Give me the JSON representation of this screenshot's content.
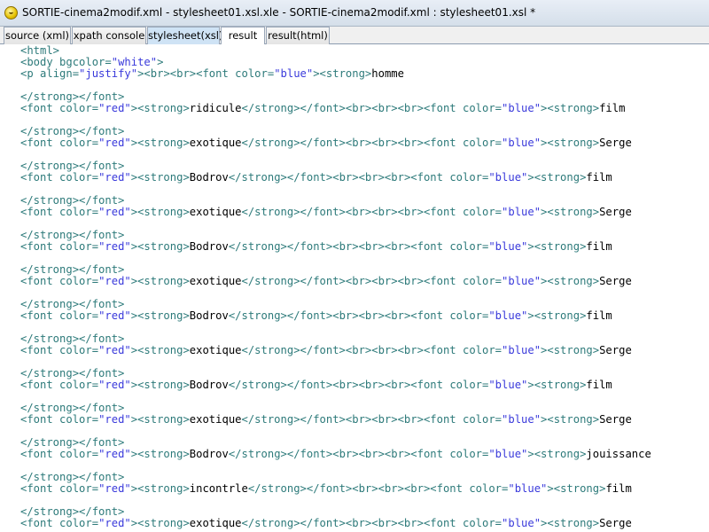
{
  "window": {
    "title": "SORTIE-cinema2modif.xml - stylesheet01.xsl.xle - SORTIE-cinema2modif.xml : stylesheet01.xsl *",
    "app_icon": "smiley-icon"
  },
  "tabs": [
    {
      "label": "source (xml)",
      "active": false
    },
    {
      "label": "xpath console",
      "active": false
    },
    {
      "label": "stylesheet(xsl)",
      "active": false,
      "highlight": true
    },
    {
      "label": "result",
      "active": true
    },
    {
      "label": "result(html)",
      "active": false
    }
  ],
  "colors": {
    "tag": "#2d7a7a",
    "attr_value": "#3a3adb",
    "text": "#000000"
  },
  "code": [
    [
      [
        "t",
        "<html>"
      ]
    ],
    [
      [
        "t",
        "<body "
      ],
      [
        "a",
        "bgcolor="
      ],
      [
        "v",
        "\"white\""
      ],
      [
        "t",
        ">"
      ]
    ],
    [
      [
        "t",
        "<p "
      ],
      [
        "a",
        "align="
      ],
      [
        "v",
        "\"justify\""
      ],
      [
        "t",
        "><br><br><font "
      ],
      [
        "a",
        "color="
      ],
      [
        "v",
        "\"blue\""
      ],
      [
        "t",
        "><strong>"
      ],
      [
        "x",
        "homme"
      ]
    ],
    [],
    [
      [
        "t",
        "</strong></font>"
      ]
    ],
    [
      [
        "t",
        "<font "
      ],
      [
        "a",
        "color="
      ],
      [
        "v",
        "\"red\""
      ],
      [
        "t",
        "><strong>"
      ],
      [
        "x",
        "ridicule"
      ],
      [
        "t",
        "</strong></font><br><br><br><font "
      ],
      [
        "a",
        "color="
      ],
      [
        "v",
        "\"blue\""
      ],
      [
        "t",
        "><strong>"
      ],
      [
        "x",
        "film"
      ]
    ],
    [],
    [
      [
        "t",
        "</strong></font>"
      ]
    ],
    [
      [
        "t",
        "<font "
      ],
      [
        "a",
        "color="
      ],
      [
        "v",
        "\"red\""
      ],
      [
        "t",
        "><strong>"
      ],
      [
        "x",
        "exotique"
      ],
      [
        "t",
        "</strong></font><br><br><br><font "
      ],
      [
        "a",
        "color="
      ],
      [
        "v",
        "\"blue\""
      ],
      [
        "t",
        "><strong>"
      ],
      [
        "x",
        "Serge"
      ]
    ],
    [],
    [
      [
        "t",
        "</strong></font>"
      ]
    ],
    [
      [
        "t",
        "<font "
      ],
      [
        "a",
        "color="
      ],
      [
        "v",
        "\"red\""
      ],
      [
        "t",
        "><strong>"
      ],
      [
        "x",
        "Bodrov"
      ],
      [
        "t",
        "</strong></font><br><br><br><font "
      ],
      [
        "a",
        "color="
      ],
      [
        "v",
        "\"blue\""
      ],
      [
        "t",
        "><strong>"
      ],
      [
        "x",
        "film"
      ]
    ],
    [],
    [
      [
        "t",
        "</strong></font>"
      ]
    ],
    [
      [
        "t",
        "<font "
      ],
      [
        "a",
        "color="
      ],
      [
        "v",
        "\"red\""
      ],
      [
        "t",
        "><strong>"
      ],
      [
        "x",
        "exotique"
      ],
      [
        "t",
        "</strong></font><br><br><br><font "
      ],
      [
        "a",
        "color="
      ],
      [
        "v",
        "\"blue\""
      ],
      [
        "t",
        "><strong>"
      ],
      [
        "x",
        "Serge"
      ]
    ],
    [],
    [
      [
        "t",
        "</strong></font>"
      ]
    ],
    [
      [
        "t",
        "<font "
      ],
      [
        "a",
        "color="
      ],
      [
        "v",
        "\"red\""
      ],
      [
        "t",
        "><strong>"
      ],
      [
        "x",
        "Bodrov"
      ],
      [
        "t",
        "</strong></font><br><br><br><font "
      ],
      [
        "a",
        "color="
      ],
      [
        "v",
        "\"blue\""
      ],
      [
        "t",
        "><strong>"
      ],
      [
        "x",
        "film"
      ]
    ],
    [],
    [
      [
        "t",
        "</strong></font>"
      ]
    ],
    [
      [
        "t",
        "<font "
      ],
      [
        "a",
        "color="
      ],
      [
        "v",
        "\"red\""
      ],
      [
        "t",
        "><strong>"
      ],
      [
        "x",
        "exotique"
      ],
      [
        "t",
        "</strong></font><br><br><br><font "
      ],
      [
        "a",
        "color="
      ],
      [
        "v",
        "\"blue\""
      ],
      [
        "t",
        "><strong>"
      ],
      [
        "x",
        "Serge"
      ]
    ],
    [],
    [
      [
        "t",
        "</strong></font>"
      ]
    ],
    [
      [
        "t",
        "<font "
      ],
      [
        "a",
        "color="
      ],
      [
        "v",
        "\"red\""
      ],
      [
        "t",
        "><strong>"
      ],
      [
        "x",
        "Bodrov"
      ],
      [
        "t",
        "</strong></font><br><br><br><font "
      ],
      [
        "a",
        "color="
      ],
      [
        "v",
        "\"blue\""
      ],
      [
        "t",
        "><strong>"
      ],
      [
        "x",
        "film"
      ]
    ],
    [],
    [
      [
        "t",
        "</strong></font>"
      ]
    ],
    [
      [
        "t",
        "<font "
      ],
      [
        "a",
        "color="
      ],
      [
        "v",
        "\"red\""
      ],
      [
        "t",
        "><strong>"
      ],
      [
        "x",
        "exotique"
      ],
      [
        "t",
        "</strong></font><br><br><br><font "
      ],
      [
        "a",
        "color="
      ],
      [
        "v",
        "\"blue\""
      ],
      [
        "t",
        "><strong>"
      ],
      [
        "x",
        "Serge"
      ]
    ],
    [],
    [
      [
        "t",
        "</strong></font>"
      ]
    ],
    [
      [
        "t",
        "<font "
      ],
      [
        "a",
        "color="
      ],
      [
        "v",
        "\"red\""
      ],
      [
        "t",
        "><strong>"
      ],
      [
        "x",
        "Bodrov"
      ],
      [
        "t",
        "</strong></font><br><br><br><font "
      ],
      [
        "a",
        "color="
      ],
      [
        "v",
        "\"blue\""
      ],
      [
        "t",
        "><strong>"
      ],
      [
        "x",
        "film"
      ]
    ],
    [],
    [
      [
        "t",
        "</strong></font>"
      ]
    ],
    [
      [
        "t",
        "<font "
      ],
      [
        "a",
        "color="
      ],
      [
        "v",
        "\"red\""
      ],
      [
        "t",
        "><strong>"
      ],
      [
        "x",
        "exotique"
      ],
      [
        "t",
        "</strong></font><br><br><br><font "
      ],
      [
        "a",
        "color="
      ],
      [
        "v",
        "\"blue\""
      ],
      [
        "t",
        "><strong>"
      ],
      [
        "x",
        "Serge"
      ]
    ],
    [],
    [
      [
        "t",
        "</strong></font>"
      ]
    ],
    [
      [
        "t",
        "<font "
      ],
      [
        "a",
        "color="
      ],
      [
        "v",
        "\"red\""
      ],
      [
        "t",
        "><strong>"
      ],
      [
        "x",
        "Bodrov"
      ],
      [
        "t",
        "</strong></font><br><br><br><font "
      ],
      [
        "a",
        "color="
      ],
      [
        "v",
        "\"blue\""
      ],
      [
        "t",
        "><strong>"
      ],
      [
        "x",
        "jouissance"
      ]
    ],
    [],
    [
      [
        "t",
        "</strong></font>"
      ]
    ],
    [
      [
        "t",
        "<font "
      ],
      [
        "a",
        "color="
      ],
      [
        "v",
        "\"red\""
      ],
      [
        "t",
        "><strong>"
      ],
      [
        "x",
        "incontrle"
      ],
      [
        "t",
        "</strong></font><br><br><br><font "
      ],
      [
        "a",
        "color="
      ],
      [
        "v",
        "\"blue\""
      ],
      [
        "t",
        "><strong>"
      ],
      [
        "x",
        "film"
      ]
    ],
    [],
    [
      [
        "t",
        "</strong></font>"
      ]
    ],
    [
      [
        "t",
        "<font "
      ],
      [
        "a",
        "color="
      ],
      [
        "v",
        "\"red\""
      ],
      [
        "t",
        "><strong>"
      ],
      [
        "x",
        "exotique"
      ],
      [
        "t",
        "</strong></font><br><br><br><font "
      ],
      [
        "a",
        "color="
      ],
      [
        "v",
        "\"blue\""
      ],
      [
        "t",
        "><strong>"
      ],
      [
        "x",
        "Serge"
      ]
    ]
  ]
}
